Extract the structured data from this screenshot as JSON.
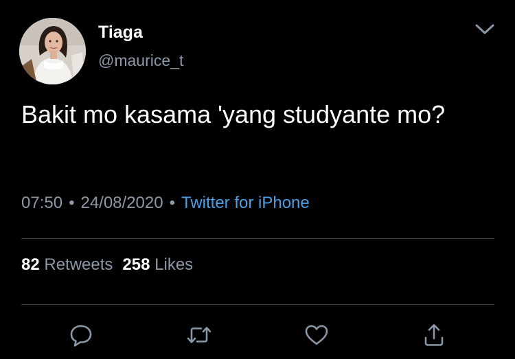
{
  "user": {
    "display_name": "Tiaga",
    "handle": "@maurice_t"
  },
  "tweet": {
    "text": "Bakit mo kasama 'yang studyante mo?",
    "time": "07:50",
    "date": "24/08/2020",
    "source": "Twitter for iPhone",
    "separator": "•"
  },
  "stats": {
    "retweets_count": "82",
    "retweets_label": "Retweets",
    "likes_count": "258",
    "likes_label": "Likes"
  },
  "icons": {
    "menu": "chevron-down-icon",
    "reply": "reply-icon",
    "retweet": "retweet-icon",
    "like": "heart-icon",
    "share": "share-icon"
  },
  "colors": {
    "background": "#000000",
    "text": "#ffffff",
    "secondary": "#8b98a5",
    "link": "#4a9fe6",
    "divider": "#3a3d40"
  }
}
